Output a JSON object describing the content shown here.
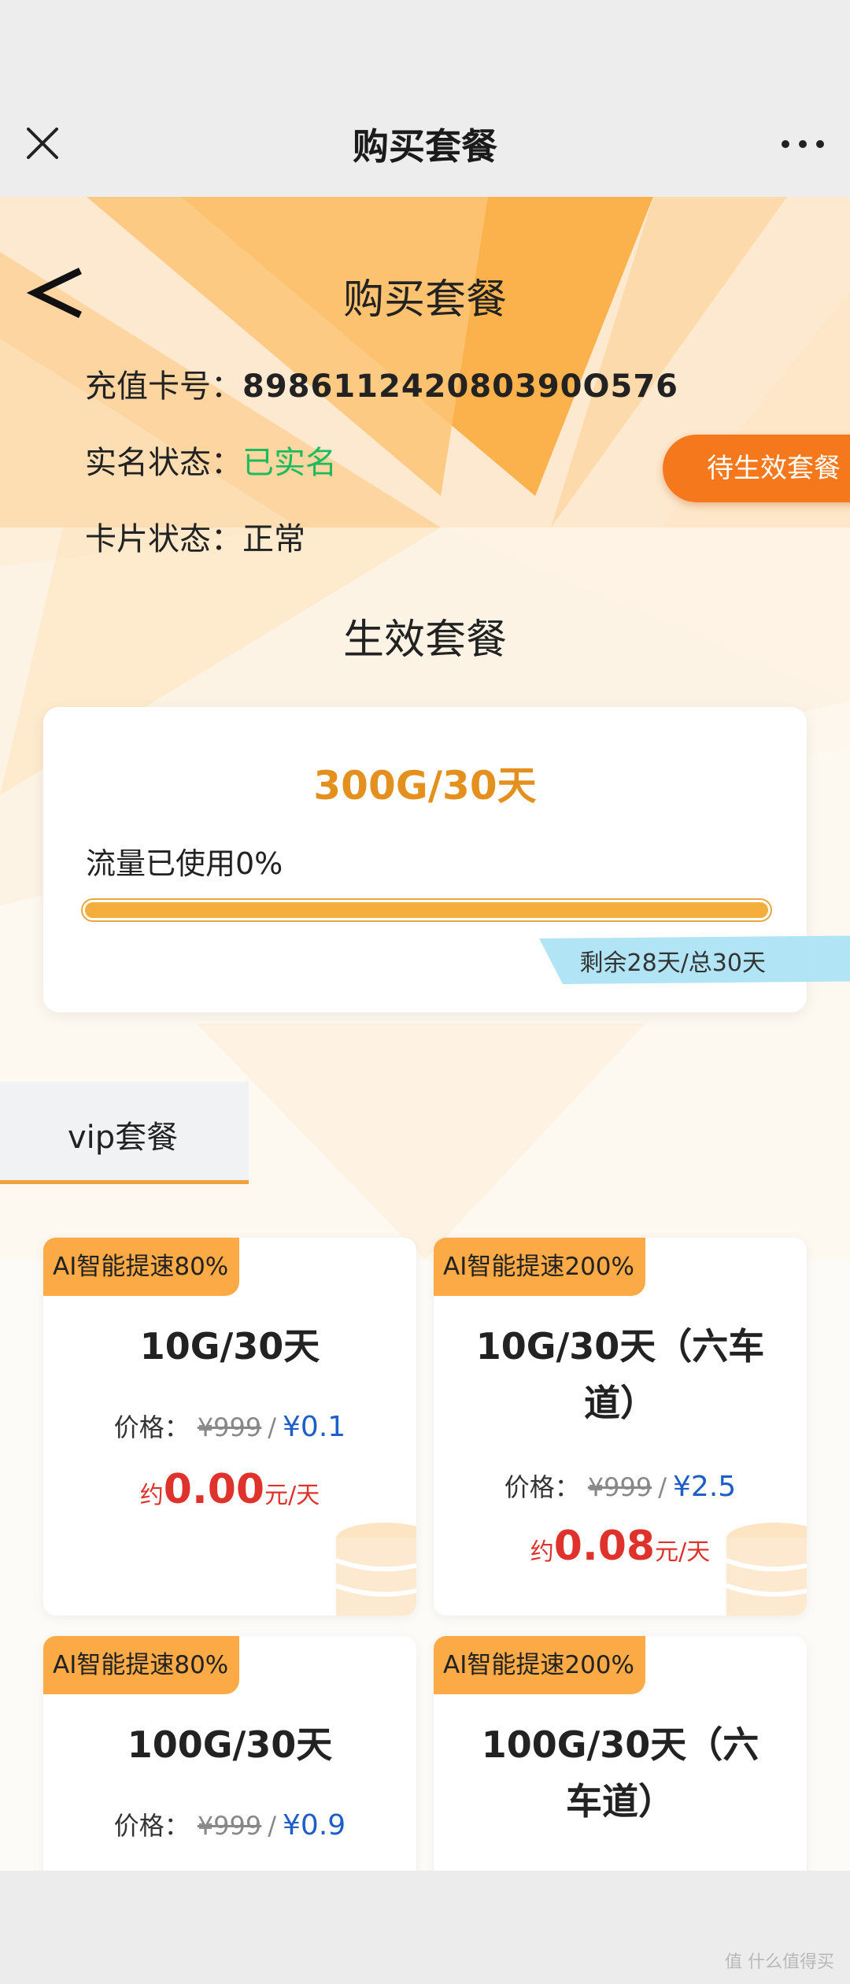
{
  "topbar": {
    "title": "购买套餐",
    "close_icon": "close-icon",
    "more_icon": "more-dots-icon"
  },
  "header": {
    "title": "购买套餐",
    "back_icon": "back-chevron-icon",
    "card_no_label": "充值卡号：",
    "card_no_value": "898611242080390O576",
    "realname_label": "实名状态：",
    "realname_value": "已实名",
    "card_status_label": "卡片状态：",
    "card_status_value": "正常",
    "pending_button": "待生效套餐"
  },
  "active": {
    "section_title": "生效套餐",
    "plan": "300G/30天",
    "usage_text": "流量已使用0%",
    "usage_percent": 0,
    "remaining": "剩余28天/总30天"
  },
  "tabs": {
    "vip_label": "vip套餐"
  },
  "packages": [
    {
      "badge": "AI智能提速80%",
      "name": "10G/30天",
      "price_label": "价格：",
      "old_price": "¥999",
      "sep": "/",
      "new_price": "¥0.1",
      "daily_prefix": "约",
      "daily_value": "0.00",
      "daily_unit": "元/天"
    },
    {
      "badge": "AI智能提速200%",
      "name": "10G/30天（六车道）",
      "price_label": "价格：",
      "old_price": "¥999",
      "sep": "/",
      "new_price": "¥2.5",
      "daily_prefix": "约",
      "daily_value": "0.08",
      "daily_unit": "元/天"
    },
    {
      "badge": "AI智能提速80%",
      "name": "100G/30天",
      "price_label": "价格：",
      "old_price": "¥999",
      "sep": "/",
      "new_price": "¥0.9"
    },
    {
      "badge": "AI智能提速200%",
      "name": "100G/30天（六车道）"
    }
  ],
  "watermark": "值 什么值得买",
  "colors": {
    "orange": "#f6781c",
    "amber": "#f5ad3c",
    "green": "#1dbb5d",
    "blue": "#1d5ec8",
    "red": "#e0322c"
  }
}
